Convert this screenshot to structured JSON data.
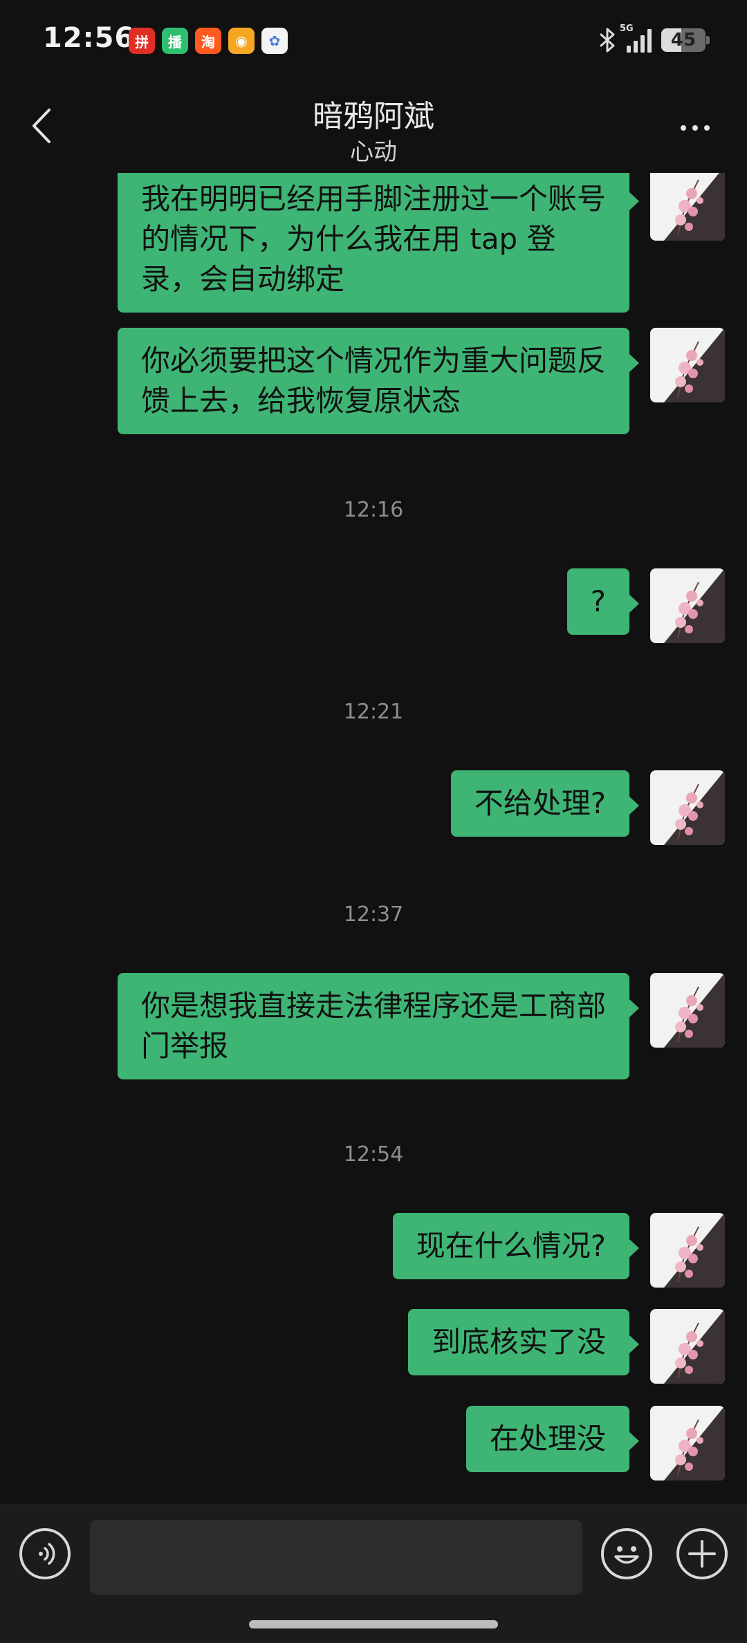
{
  "status_bar": {
    "time": "12:56",
    "app_icons": [
      {
        "name": "pinduoduo-icon",
        "glyph": "拼",
        "color": "#e02e24"
      },
      {
        "name": "bobo-icon",
        "glyph": "播",
        "color": "#2fbf71"
      },
      {
        "name": "taobao-icon",
        "glyph": "淘",
        "color": "#ff5a1f"
      },
      {
        "name": "weibo-icon",
        "glyph": "◉",
        "color": "#f5a623"
      },
      {
        "name": "cloud-icon",
        "glyph": "✿",
        "color": "#f4f4f4"
      }
    ],
    "network": "5G",
    "battery": "45"
  },
  "header": {
    "title": "暗鸦阿斌",
    "subtitle": "心动"
  },
  "messages": [
    {
      "type": "sent",
      "text": "我在明明已经用手脚注册过一个账号的情况下，为什么我在用 tap 登录，会自动绑定"
    },
    {
      "type": "sent",
      "text": "你必须要把这个情况作为重大问题反馈上去，给我恢复原状态"
    },
    {
      "type": "time",
      "text": "12:16"
    },
    {
      "type": "sent",
      "text": "?"
    },
    {
      "type": "time",
      "text": "12:21"
    },
    {
      "type": "sent",
      "text": "不给处理?"
    },
    {
      "type": "time",
      "text": "12:37"
    },
    {
      "type": "sent",
      "text": "你是想我直接走法律程序还是工商部门举报"
    },
    {
      "type": "time",
      "text": "12:54"
    },
    {
      "type": "sent",
      "text": "现在什么情况?"
    },
    {
      "type": "sent",
      "text": "到底核实了没"
    },
    {
      "type": "sent",
      "text": "在处理没"
    }
  ],
  "input_bar": {
    "placeholder": ""
  },
  "colors": {
    "bubble": "#3eb575",
    "background": "#111111",
    "input_bar": "#1c1c1c"
  }
}
